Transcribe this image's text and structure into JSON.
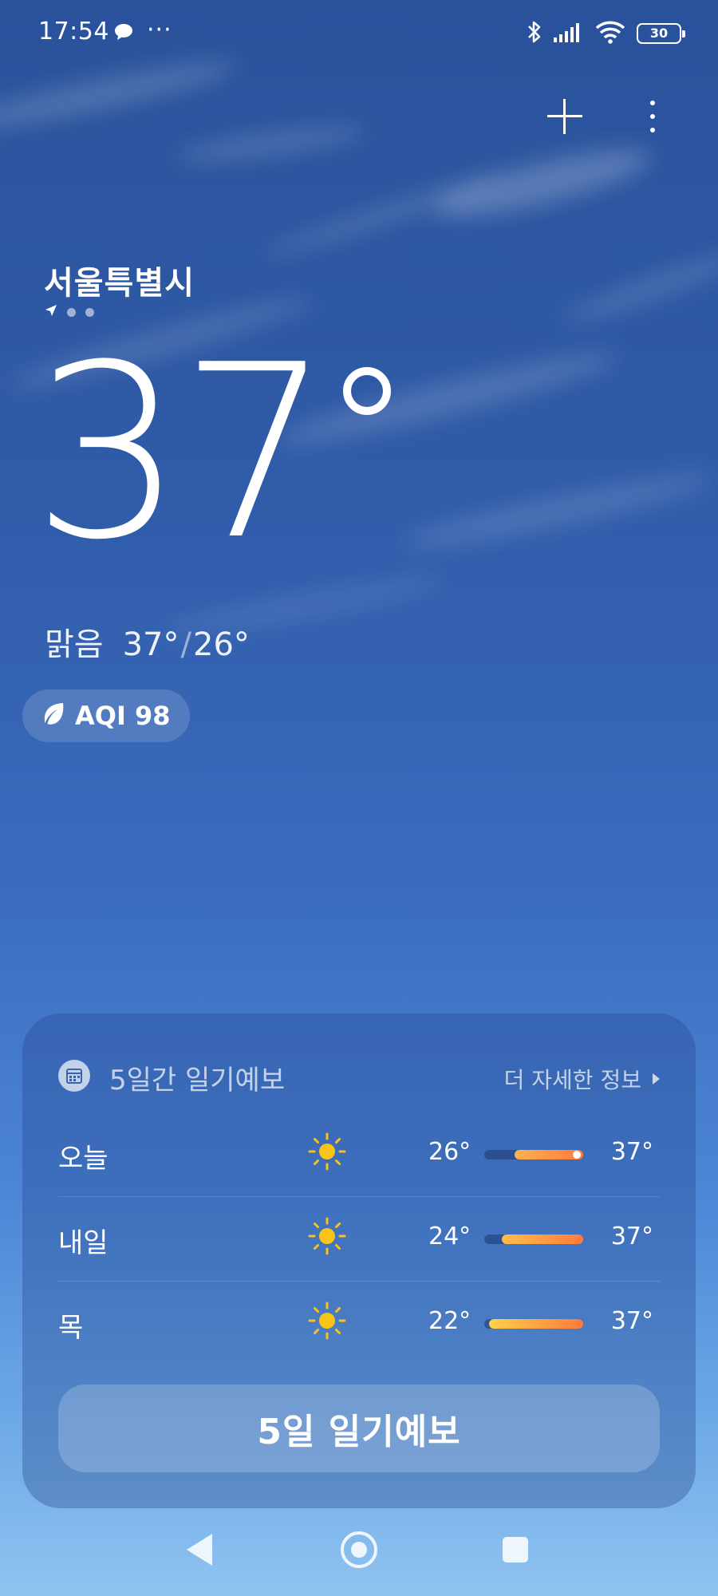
{
  "status_bar": {
    "time": "17:54",
    "overflow": "···",
    "battery": "30",
    "icons": [
      "chat-bubble-icon",
      "bluetooth-icon",
      "signal-icon",
      "wifi-icon",
      "battery-icon"
    ]
  },
  "top_actions": {
    "add_icon": "plus-icon",
    "more_icon": "more-vertical-icon"
  },
  "location": {
    "city": "서울특별시",
    "page_count": 3,
    "current_icon": "location-arrow-icon"
  },
  "current": {
    "temperature": "37",
    "condition": "맑음",
    "high": "37°",
    "low": "26°",
    "separator": "/"
  },
  "aqi": {
    "label": "AQI 98",
    "icon": "leaf-icon"
  },
  "forecast": {
    "title": "5일간 일기예보",
    "more_link": "더 자세한 정보",
    "days": [
      {
        "day": "오늘",
        "icon": "sun-icon",
        "low": "26°",
        "high": "37°",
        "is_today": true
      },
      {
        "day": "내일",
        "icon": "sun-icon",
        "low": "24°",
        "high": "37°",
        "is_today": false
      },
      {
        "day": "목",
        "icon": "sun-icon",
        "low": "22°",
        "high": "37°",
        "is_today": false
      }
    ],
    "cta_label": "5일 일기예보"
  },
  "colors": {
    "sun": "#f8c41a",
    "bar_warm": "#ff8a3c",
    "bar_cool": "#ffc04a"
  }
}
